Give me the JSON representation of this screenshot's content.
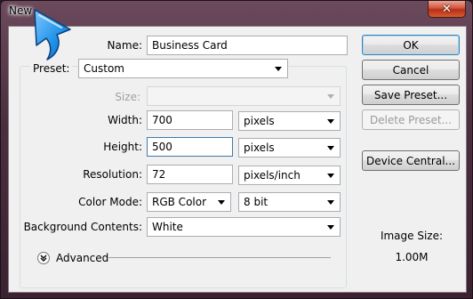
{
  "window": {
    "title": "New",
    "close_glyph": "✕"
  },
  "form": {
    "name_label": "Name:",
    "name_value": "Business Card",
    "preset_label": "Preset:",
    "preset_value": "Custom",
    "size_label": "Size:",
    "size_value": "",
    "width_label": "Width:",
    "width_value": "700",
    "width_unit": "pixels",
    "height_label": "Height:",
    "height_value": "500",
    "height_unit": "pixels",
    "resolution_label": "Resolution:",
    "resolution_value": "72",
    "resolution_unit": "pixels/inch",
    "color_mode_label": "Color Mode:",
    "color_mode_value": "RGB Color",
    "bit_depth_value": "8 bit",
    "background_label": "Background Contents:",
    "background_value": "White",
    "advanced_label": "Advanced"
  },
  "buttons": {
    "ok": "OK",
    "cancel": "Cancel",
    "save_preset": "Save Preset...",
    "delete_preset": "Delete Preset...",
    "device_central": "Device Central..."
  },
  "image_size": {
    "label": "Image Size:",
    "value": "1.00M"
  },
  "icons": {
    "cursor": "arrow-icon",
    "close": "close-icon",
    "advanced_toggle": "chevron-double-down-icon",
    "dropdown": "caret-down-icon"
  },
  "colors": {
    "accent": "#3c7fb1",
    "cursor_blue": "#1e90e8",
    "close_red": "#c7401f"
  }
}
